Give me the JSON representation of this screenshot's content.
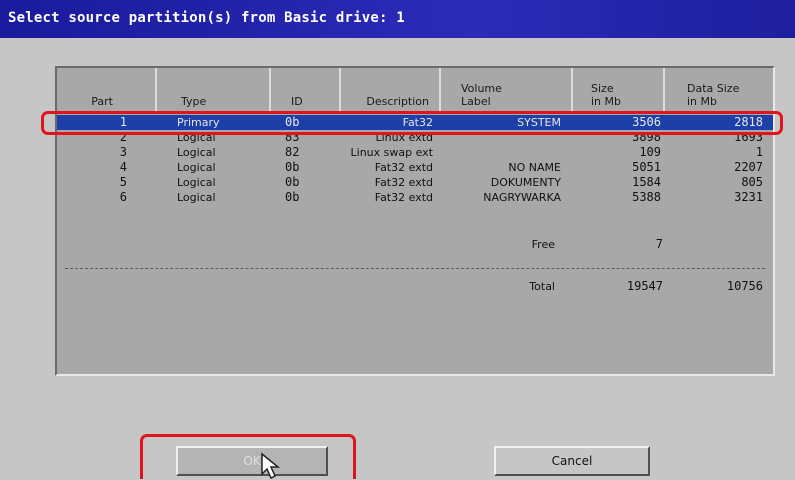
{
  "window": {
    "title": "Select source partition(s) from Basic drive: 1"
  },
  "table": {
    "columns": [
      {
        "l1": "",
        "l2": "Part"
      },
      {
        "l1": "",
        "l2": "Type"
      },
      {
        "l1": "",
        "l2": "ID"
      },
      {
        "l1": "",
        "l2": "Description"
      },
      {
        "l1": "Volume",
        "l2": "Label"
      },
      {
        "l1": "Size",
        "l2": "in Mb"
      },
      {
        "l1": "Data Size",
        "l2": "in Mb"
      }
    ],
    "rows": [
      {
        "part": "1",
        "type": "Primary",
        "id": "0b",
        "description": "Fat32",
        "label": "SYSTEM",
        "size": "3506",
        "data_size": "2818",
        "selected": true
      },
      {
        "part": "2",
        "type": "Logical",
        "id": "83",
        "description": "Linux extd",
        "label": "",
        "size": "3898",
        "data_size": "1693",
        "selected": false
      },
      {
        "part": "3",
        "type": "Logical",
        "id": "82",
        "description": "Linux swap ext",
        "label": "",
        "size": "109",
        "data_size": "1",
        "selected": false
      },
      {
        "part": "4",
        "type": "Logical",
        "id": "0b",
        "description": "Fat32 extd",
        "label": "NO NAME",
        "size": "5051",
        "data_size": "2207",
        "selected": false
      },
      {
        "part": "5",
        "type": "Logical",
        "id": "0b",
        "description": "Fat32 extd",
        "label": "DOKUMENTY",
        "size": "1584",
        "data_size": "805",
        "selected": false
      },
      {
        "part": "6",
        "type": "Logical",
        "id": "0b",
        "description": "Fat32 extd",
        "label": "NAGRYWARKA",
        "size": "5388",
        "data_size": "3231",
        "selected": false
      }
    ],
    "free": {
      "label": "Free",
      "size": "7"
    },
    "total": {
      "label": "Total",
      "size": "19547",
      "data_size": "10756"
    }
  },
  "buttons": {
    "ok": "OK",
    "cancel": "Cancel"
  },
  "colors": {
    "title_bar": "#1a1a9c",
    "selection": "#1c3fa8",
    "highlight_annotation": "#e0141c"
  },
  "icons": {
    "cursor": "mouse-pointer-icon"
  }
}
